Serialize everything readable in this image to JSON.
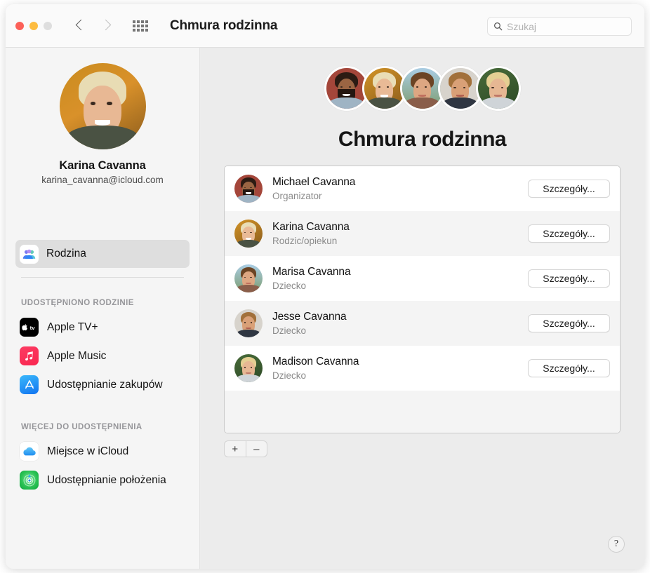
{
  "window": {
    "title": "Chmura rodzinna",
    "traffic_lights": [
      "close",
      "minimize",
      "zoom"
    ]
  },
  "toolbar": {
    "back_icon": "chevron-left-icon",
    "forward_icon": "chevron-right-icon",
    "grid_icon": "show-all-grid-icon",
    "search": {
      "placeholder": "Szukaj",
      "value": "",
      "icon": "search-icon"
    }
  },
  "sidebar": {
    "profile": {
      "name": "Karina Cavanna",
      "email": "karina_cavanna@icloud.com",
      "avatar": "karina-avatar"
    },
    "selected_item": {
      "label": "Rodzina",
      "icon": "family-icon",
      "selected": true
    },
    "sections": [
      {
        "label": "UDOSTĘPNIONO RODZINIE",
        "items": [
          {
            "label": "Apple TV+",
            "icon": "apple-tv-icon",
            "color": "#000000"
          },
          {
            "label": "Apple Music",
            "icon": "apple-music-icon",
            "color": "#fa233b"
          },
          {
            "label": "Udostępnianie zakupów",
            "icon": "app-store-icon",
            "color": "#1e9bf5"
          }
        ]
      },
      {
        "label": "WIĘCEJ DO UDOSTĘPNIENIA",
        "items": [
          {
            "label": "Miejsce w iCloud",
            "icon": "icloud-icon",
            "color": "#ffffff"
          },
          {
            "label": "Udostępnianie położenia",
            "icon": "find-my-icon",
            "color": "#32c759"
          }
        ]
      }
    ]
  },
  "main": {
    "title": "Chmura rodzinna",
    "header_avatars": [
      "michael-avatar",
      "karina-avatar",
      "marisa-avatar",
      "jesse-avatar",
      "madison-avatar"
    ],
    "members": [
      {
        "name": "Michael Cavanna",
        "role": "Organizator",
        "action": "Szczegóły...",
        "avatar": "michael-avatar"
      },
      {
        "name": "Karina Cavanna",
        "role": "Rodzic/opiekun",
        "action": "Szczegóły...",
        "avatar": "karina-avatar"
      },
      {
        "name": "Marisa Cavanna",
        "role": "Dziecko",
        "action": "Szczegóły...",
        "avatar": "marisa-avatar"
      },
      {
        "name": "Jesse Cavanna",
        "role": "Dziecko",
        "action": "Szczegóły...",
        "avatar": "jesse-avatar"
      },
      {
        "name": "Madison Cavanna",
        "role": "Dziecko",
        "action": "Szczegóły...",
        "avatar": "madison-avatar"
      }
    ],
    "add_button": "+",
    "remove_button": "–",
    "help_button": "?"
  },
  "colors": {
    "window_bg": "#ececec",
    "sidebar_bg": "#f5f5f5",
    "toolbar_bg": "#fafafa",
    "card_bg": "#ffffff",
    "row_alt_bg": "#f4f4f4",
    "selection_bg": "#dedede",
    "text_primary": "#111111",
    "text_secondary": "#8b8b8b",
    "section_label": "#96969a"
  }
}
